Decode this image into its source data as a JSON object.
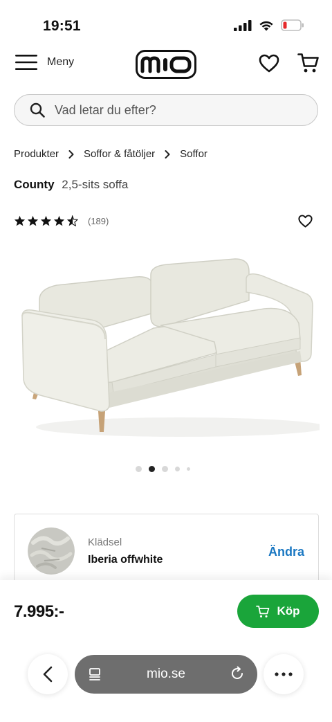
{
  "status_bar": {
    "time": "19:51"
  },
  "topnav": {
    "menu_label": "Meny",
    "logo_text": "mio"
  },
  "search": {
    "placeholder": "Vad letar du efter?"
  },
  "breadcrumb": [
    "Produkter",
    "Soffor & fåtöljer",
    "Soffor"
  ],
  "product": {
    "name": "County",
    "subtitle": "2,5-sits soffa",
    "rating": 4.5,
    "rating_count": "(189)",
    "image_count": 5,
    "active_image": 2
  },
  "upholstery": {
    "label": "Klädsel",
    "value": "Iberia offwhite",
    "change_label": "Ändra"
  },
  "buy": {
    "price": "7.995:-",
    "button_label": "Köp"
  },
  "browser": {
    "url": "mio.se"
  },
  "colors": {
    "buy_green": "#1aa53a",
    "link_blue": "#1b78c2",
    "url_pill": "#6e6e6e"
  }
}
